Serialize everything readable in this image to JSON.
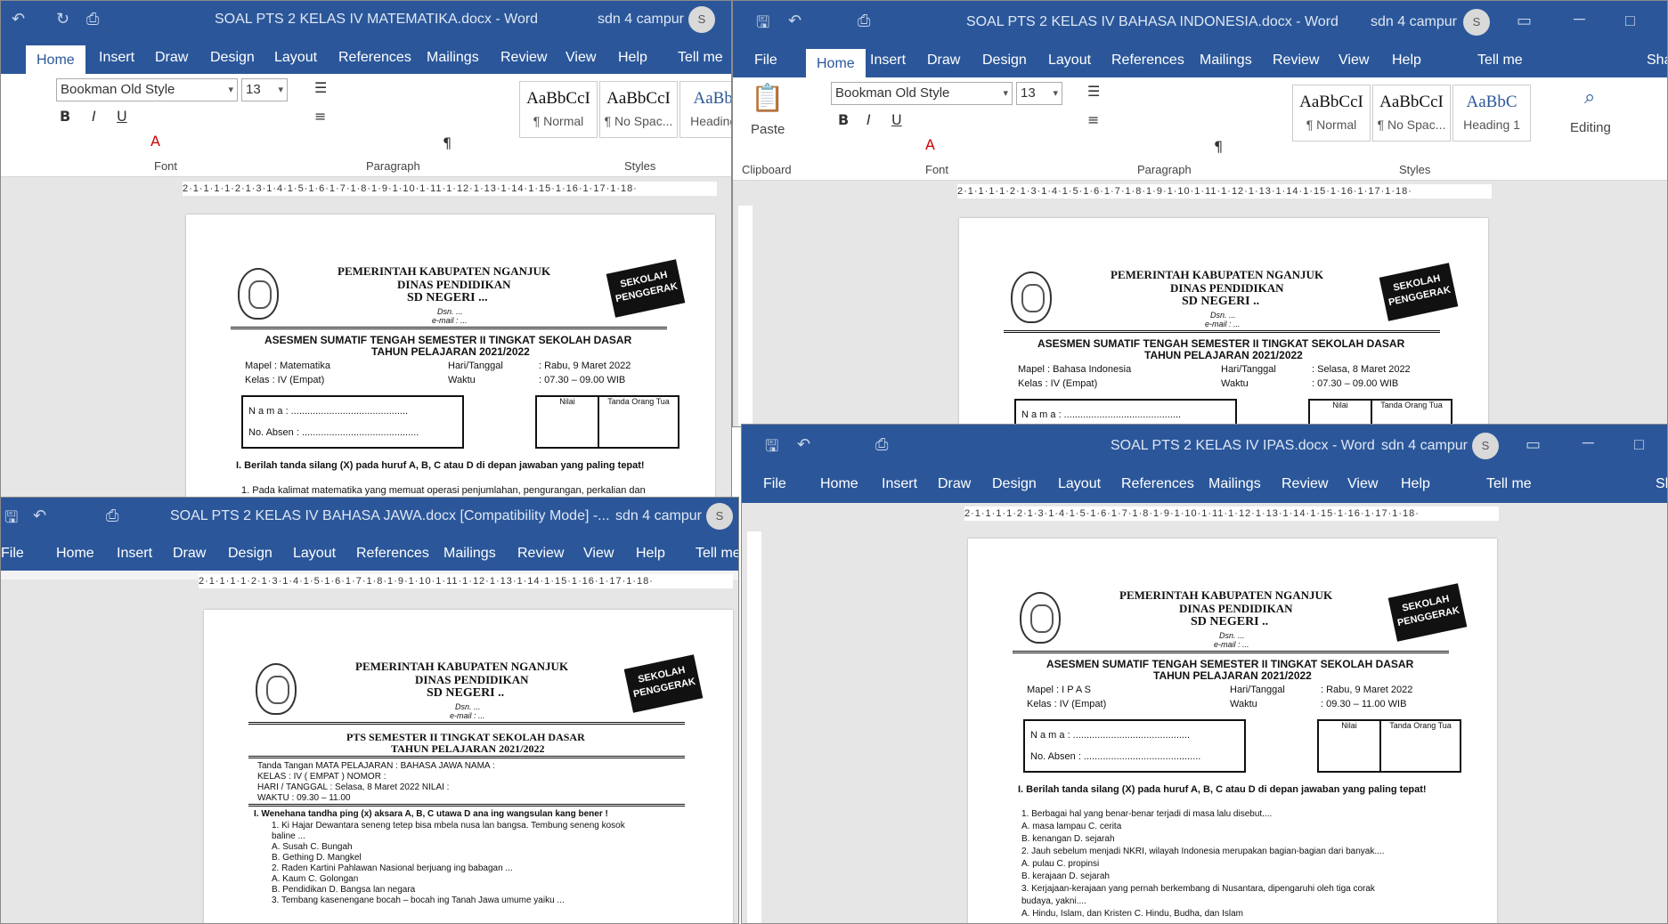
{
  "colors": {
    "brand": "#2b579a",
    "titlebar_text": "#dfe7f3"
  },
  "common": {
    "user": "sdn 4 campur",
    "avatar": "S",
    "tabs": [
      "File",
      "Home",
      "Insert",
      "Draw",
      "Design",
      "Layout",
      "References",
      "Mailings",
      "Review",
      "View",
      "Help",
      "Tell me"
    ],
    "font_name": "Bookman Old Style",
    "font_size": "13",
    "styles": [
      {
        "preview": "AaBbCcI",
        "name": "¶ Normal"
      },
      {
        "preview": "AaBbCcI",
        "name": "¶ No Spac..."
      },
      {
        "preview": "AaBbC",
        "name": "Heading 1"
      }
    ],
    "groups": {
      "clipboard": "Clipboard",
      "font": "Font",
      "paragraph": "Paragraph",
      "styles": "Styles",
      "editing": "Editing",
      "paste": "Paste"
    },
    "share": "Sha",
    "ruler": "2·1·1·1·1·2·1·3·1·4·1·5·1·6·1·7·1·8·1·9·1·10·1·11·1·12·1·13·1·14·1·15·1·16·1·17·1·18·",
    "hdr1": "PEMERINTAH KABUPATEN NGANJUK",
    "hdr2": "DINAS PENDIDIKAN",
    "dsn": "Dsn. ...",
    "email": "e-mail : ...",
    "sekolah": "SEKOLAH PENGGERAK",
    "tahun": "TAHUN PELAJARAN 2021/2022",
    "asesmen": "ASESMEN SUMATIF TENGAH SEMESTER II TINGKAT SEKOLAH DASAR",
    "nama": "N a m a   : ...........................................",
    "absen": "No. Absen  : ...........................................",
    "nilai": "Nilai",
    "tanda": "Tanda Orang Tua"
  },
  "windows": [
    {
      "title": "SOAL PTS 2 KELAS IV MATEMATIKA.docx  -  Word",
      "sd": "SD NEGERI ...",
      "mapel": "Mapel      : Matematika",
      "kelas": "Kelas       : IV (Empat)",
      "hari": "Hari/Tanggal",
      "waktu": "Waktu",
      "tgl": ": Rabu, 9 Maret 2022",
      "jam": ": 07.30 – 09.00 WIB",
      "instr": "I.   Berilah tanda silang (X) pada huruf A, B, C atau D di depan jawaban yang paling tepat!",
      "q1": "1.   Pada kalimat matematika yang memuat operasi penjumlahan, pengurangan, perkalian dan"
    },
    {
      "title": "SOAL PTS 2 KELAS IV BAHASA INDONESIA.docx  -  Word",
      "sd": "SD NEGERI ..",
      "mapel": "Mapel      : Bahasa Indonesia",
      "kelas": "Kelas       : IV (Empat)",
      "hari": "Hari/Tanggal",
      "waktu": "Waktu",
      "tgl": ": Selasa, 8 Maret 2022",
      "jam": ": 07.30 – 09.00 WIB"
    },
    {
      "title": "SOAL PTS 2 KELAS IV BAHASA JAWA.docx [Compatibility Mode]  -...",
      "sd": "SD NEGERI ..",
      "pts": "PTS SEMESTER II TINGKAT SEKOLAH DASAR",
      "lines": [
        "Tanda Tangan    MATA PELAJARAN    :    BAHASA JAWA         NAMA      :",
        "                          KELAS                    :    IV ( EMPAT )           NOMOR    :",
        "                          HARI / TANGGAL     :    Selasa, 8 Maret 2022    NILAI       :",
        "                          WAKTU                   :    09.30 – 11.00"
      ],
      "q": [
        "I.    Wenehana tandha ping (x) aksara A, B, C utawa D ana ing wangsulan kang bener !",
        "1.   Ki Hajar Dewantara seneng tetep bisa mbela nusa lan bangsa. Tembung seneng kosok",
        "      baline ...",
        "      A.  Susah                                          C.  Bungah",
        "      B.  Gething                                        D.  Mangkel",
        "2.   Raden  Kartini Pahlawan Nasional berjuang ing babagan ...",
        "      A.  Kaum                                           C.  Golongan",
        "      B.  Pendidikan                                   D.  Bangsa lan negara",
        "3.   Tembang kasenengane bocah – bocah ing Tanah Jawa umume yaiku ..."
      ]
    },
    {
      "title": "SOAL PTS 2 KELAS IV IPAS.docx  -  Word",
      "sd": "SD NEGERI ..",
      "mapel": "Mapel      : I P A S",
      "kelas": "Kelas       : IV (Empat)",
      "hari": "Hari/Tanggal",
      "waktu": "Waktu",
      "tgl": ": Rabu, 9 Maret 2022",
      "jam": ": 09.30 – 11.00 WIB",
      "instr": "I.   Berilah tanda silang (X) pada huruf A, B, C atau D di depan jawaban yang paling tepat!",
      "q": [
        "1.    Berbagai hal yang benar-benar terjadi di masa lalu disebut....",
        "       A.  masa lampau                                                  C.  cerita",
        "       B.  kenangan                                                       D.  sejarah",
        "2.    Jauh sebelum menjadi NKRI, wilayah Indonesia merupakan bagian-bagian dari banyak....",
        "       A.  pulau                                                              C.  propinsi",
        "       B.  kerajaan                                                        D.  sejarah",
        "3.    Kerjajaan-kerajaan yang pernah berkembang di Nusantara, dipengaruhi oleh tiga corak",
        "       budaya, yakni....",
        "       A.  Hindu, Islam, dan Kristen                                C.  Hindu, Budha, dan Islam"
      ]
    }
  ]
}
